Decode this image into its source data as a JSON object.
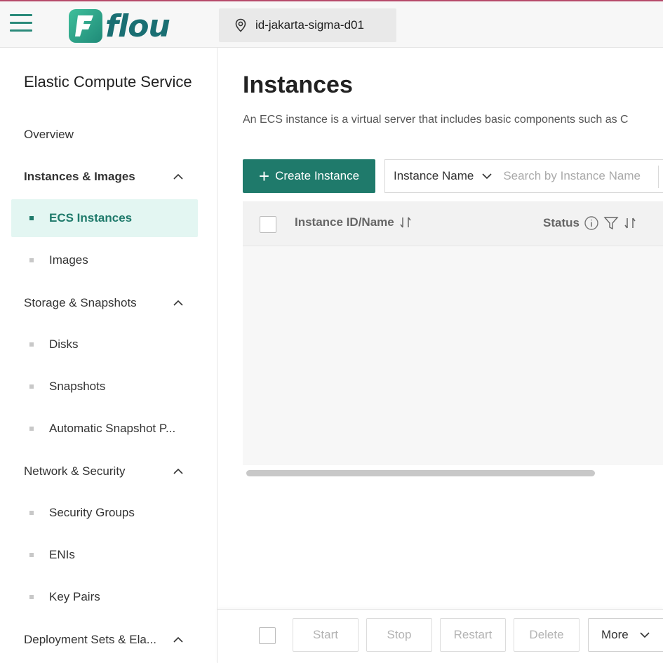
{
  "header": {
    "brand": "flou",
    "logo_letter": "F",
    "region": "id-jakarta-sigma-d01",
    "accent_color": "#1f7a6b",
    "top_border_color": "#b64a6a"
  },
  "sidebar": {
    "title": "Elastic Compute Service",
    "overview": "Overview",
    "groups": [
      {
        "label": "Instances & Images",
        "items": [
          "ECS Instances",
          "Images"
        ]
      },
      {
        "label": "Storage & Snapshots",
        "items": [
          "Disks",
          "Snapshots",
          "Automatic Snapshot P..."
        ]
      },
      {
        "label": "Network & Security",
        "items": [
          "Security Groups",
          "ENIs",
          "Key Pairs"
        ]
      },
      {
        "label": "Deployment Sets & Ela...",
        "items": []
      }
    ],
    "active_item": "ECS Instances"
  },
  "main": {
    "title": "Instances",
    "description": "An ECS instance is a virtual server that includes basic components such as C",
    "create_button": "Create Instance",
    "search": {
      "field": "Instance Name",
      "placeholder": "Search by Instance Name"
    },
    "table": {
      "columns": [
        "Instance ID/Name",
        "Status"
      ]
    }
  },
  "footer": {
    "buttons": [
      "Start",
      "Stop",
      "Restart",
      "Delete"
    ],
    "more": "More"
  },
  "icons": {
    "menu": "hamburger-menu-icon",
    "location": "location-pin-icon",
    "chevron_up": "chevron-up-icon",
    "chevron_down": "chevron-down-icon",
    "sort": "sort-icon",
    "info": "info-icon",
    "filter": "filter-icon",
    "plus": "plus-icon"
  }
}
